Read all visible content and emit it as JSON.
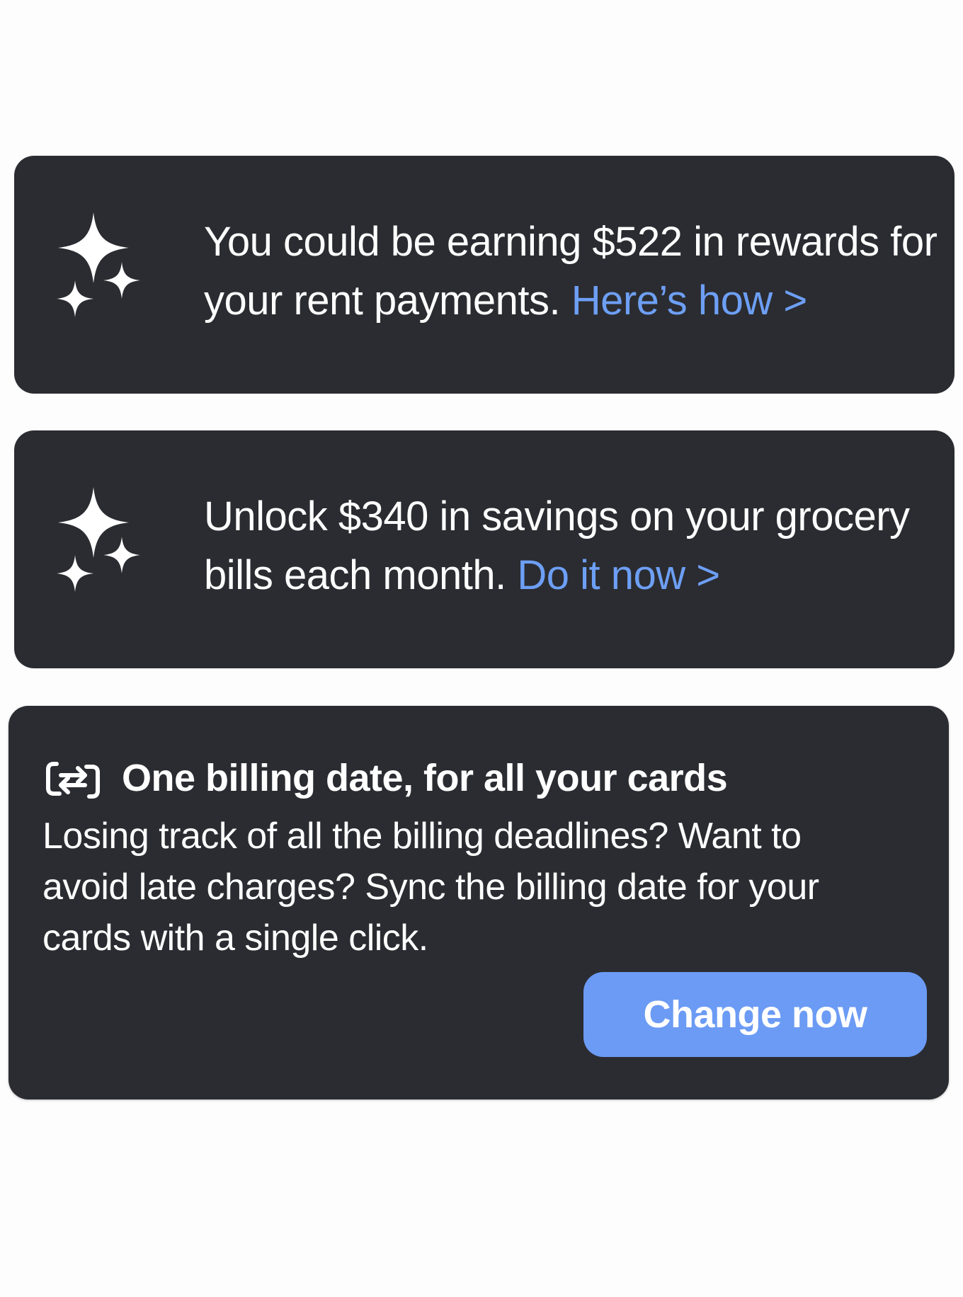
{
  "colors": {
    "card_background": "#2b2c31",
    "accent": "#6d9ff5",
    "button_background": "#6b9bf4",
    "page_background": "#fdfdfd",
    "text": "#ffffff"
  },
  "promos": [
    {
      "icon": "sparkle-icon",
      "text": "You could be earning $522 in rewards for your rent payments.",
      "link_label": "Here’s how >"
    },
    {
      "icon": "sparkle-icon",
      "text": "Unlock $340 in savings on your grocery bills each month.",
      "link_label": "Do it now >"
    }
  ],
  "billing_card": {
    "icon": "sync-icon",
    "title": "One billing date, for all your cards",
    "description": "Losing track of all the billing deadlines? Want to avoid late charges? Sync the billing date for your cards with a single click.",
    "button_label": "Change now"
  }
}
